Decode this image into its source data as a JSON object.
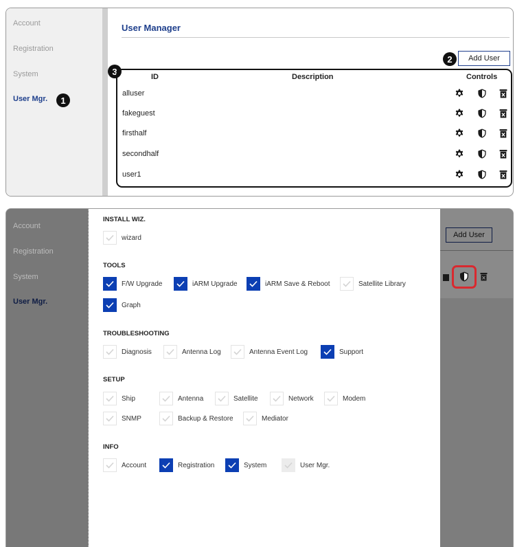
{
  "top_panel": {
    "sidebar": [
      {
        "label": "Account"
      },
      {
        "label": "Registration"
      },
      {
        "label": "System"
      },
      {
        "label": "User Mgr."
      }
    ],
    "title": "User Manager",
    "add_user_label": "Add User",
    "callouts": [
      "1",
      "2",
      "3"
    ],
    "table": {
      "columns": [
        "ID",
        "Description",
        "Controls"
      ],
      "rows": [
        {
          "id": "alluser",
          "description": ""
        },
        {
          "id": "fakeguest",
          "description": ""
        },
        {
          "id": "firsthalf",
          "description": ""
        },
        {
          "id": "secondhalf",
          "description": ""
        },
        {
          "id": "user1",
          "description": ""
        }
      ],
      "row_controls": [
        "settings-gear-icon",
        "permissions-shield-icon",
        "delete-trash-icon"
      ]
    }
  },
  "bottom_panel": {
    "sidebar": [
      {
        "label": "Account"
      },
      {
        "label": "Registration"
      },
      {
        "label": "System"
      },
      {
        "label": "User Mgr."
      }
    ],
    "add_user_label": "Add User",
    "highlight_color": "#d9292f",
    "permissions": {
      "install_wiz": {
        "title": "INSTALL WIZ.",
        "items": [
          {
            "label": "wizard",
            "checked": false
          }
        ]
      },
      "tools": {
        "title": "TOOLS",
        "items": [
          {
            "label": "F/W Upgrade",
            "checked": true
          },
          {
            "label": "iARM Upgrade",
            "checked": true
          },
          {
            "label": "iARM Save & Reboot",
            "checked": true
          },
          {
            "label": "Satellite Library",
            "checked": false
          },
          {
            "label": "Graph",
            "checked": true
          }
        ]
      },
      "troubleshooting": {
        "title": "TROUBLESHOOTING",
        "items": [
          {
            "label": "Diagnosis",
            "checked": false
          },
          {
            "label": "Antenna Log",
            "checked": false
          },
          {
            "label": "Antenna Event Log",
            "checked": false
          },
          {
            "label": "Support",
            "checked": true
          }
        ]
      },
      "setup": {
        "title": "SETUP",
        "items": [
          {
            "label": "Ship",
            "checked": false
          },
          {
            "label": "Antenna",
            "checked": false
          },
          {
            "label": "Satellite",
            "checked": false
          },
          {
            "label": "Network",
            "checked": false
          },
          {
            "label": "Modem",
            "checked": false
          },
          {
            "label": "SNMP",
            "checked": false
          },
          {
            "label": "Backup & Restore",
            "checked": false
          },
          {
            "label": "Mediator",
            "checked": false
          }
        ]
      },
      "info": {
        "title": "INFO",
        "items": [
          {
            "label": "Account",
            "checked": false
          },
          {
            "label": "Registration",
            "checked": true
          },
          {
            "label": "System",
            "checked": true
          },
          {
            "label": "User Mgr.",
            "checked": false,
            "disabled": true
          }
        ]
      }
    }
  },
  "colors": {
    "accent": "#1e3f8c",
    "checkbox_checked": "#0c3fb3",
    "overlay": "#7d7d7d"
  }
}
